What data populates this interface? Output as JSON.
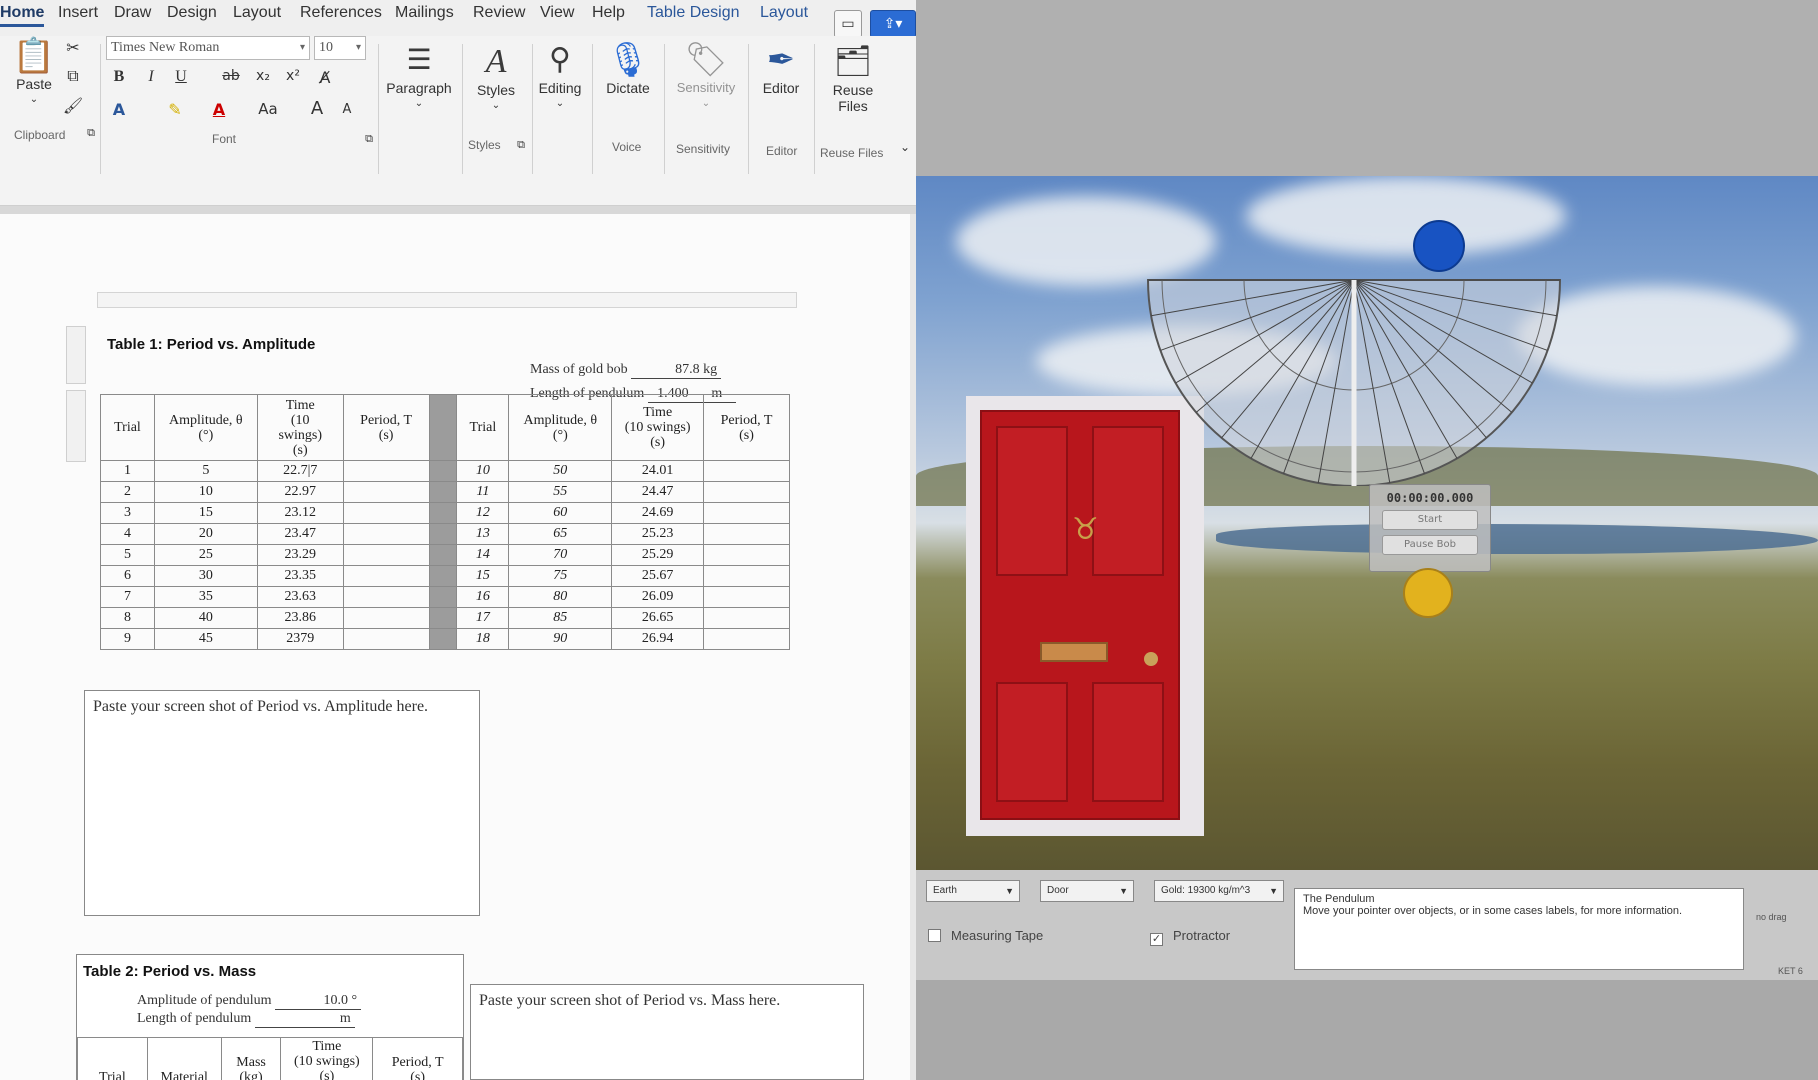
{
  "word": {
    "tabs": [
      {
        "label": "Home"
      },
      {
        "label": "Insert"
      },
      {
        "label": "Draw"
      },
      {
        "label": "Design"
      },
      {
        "label": "Layout"
      },
      {
        "label": "References"
      },
      {
        "label": "Mailings"
      },
      {
        "label": "Review"
      },
      {
        "label": "View"
      },
      {
        "label": "Help"
      },
      {
        "label": "Table Design"
      },
      {
        "label": "Layout"
      }
    ],
    "ribbon": {
      "paste_label": "Paste",
      "clipboard_group": "Clipboard",
      "font_name": "Times New Roman",
      "font_size": "10",
      "font_group": "Font",
      "bold": "B",
      "italic": "I",
      "underline": "U",
      "strike": "ab",
      "subscript": "x₂",
      "superscript": "x²",
      "case": "Aa",
      "grow": "A",
      "shrink": "A",
      "paragraph": "Paragraph",
      "styles": "Styles",
      "styles_group": "Styles",
      "editing": "Editing",
      "dictate": "Dictate",
      "voice_group": "Voice",
      "sensitivity": "Sensitivity",
      "sensitivity_group": "Sensitivity",
      "editor": "Editor",
      "editor_group": "Editor",
      "reuse_files_1": "Reuse",
      "reuse_files_2": "Files",
      "reuse_group": "Reuse Files"
    },
    "table1": {
      "caption": "Table 1:  Period vs. Amplitude",
      "mass_label": "Mass of gold bob",
      "mass_value": "87.8 kg",
      "length_label": "Length of pendulum",
      "length_value": "1.400",
      "length_unit": "m",
      "headers": {
        "trial": "Trial",
        "amplitude_1": "Amplitude, θ",
        "amplitude_2": "(°)",
        "time_1": "Time",
        "time_2": "(10",
        "time_3": "swings)",
        "time_4": "(s)",
        "time_r_1": "Time",
        "time_r_2": "(10 swings)",
        "time_r_3": "(s)",
        "period_1": "Period, T",
        "period_2": "(s)"
      },
      "left_rows": [
        {
          "trial": "1",
          "amp": "5",
          "time": "22.7|7"
        },
        {
          "trial": "2",
          "amp": "10",
          "time": "22.97"
        },
        {
          "trial": "3",
          "amp": "15",
          "time": "23.12"
        },
        {
          "trial": "4",
          "amp": "20",
          "time": "23.47"
        },
        {
          "trial": "5",
          "amp": "25",
          "time": "23.29"
        },
        {
          "trial": "6",
          "amp": "30",
          "time": "23.35"
        },
        {
          "trial": "7",
          "amp": "35",
          "time": "23.63"
        },
        {
          "trial": "8",
          "amp": "40",
          "time": "23.86"
        },
        {
          "trial": "9",
          "amp": "45",
          "time": "2379"
        }
      ],
      "right_rows": [
        {
          "trial": "10",
          "amp": "50",
          "time": "24.01"
        },
        {
          "trial": "11",
          "amp": "55",
          "time": "24.47"
        },
        {
          "trial": "12",
          "amp": "60",
          "time": "24.69"
        },
        {
          "trial": "13",
          "amp": "65",
          "time": "25.23"
        },
        {
          "trial": "14",
          "amp": "70",
          "time": "25.29"
        },
        {
          "trial": "15",
          "amp": "75",
          "time": "25.67"
        },
        {
          "trial": "16",
          "amp": "80",
          "time": "26.09"
        },
        {
          "trial": "17",
          "amp": "85",
          "time": "26.65"
        },
        {
          "trial": "18",
          "amp": "90",
          "time": "26.94"
        }
      ]
    },
    "paste_box_1": "Paste your screen shot of Period vs. Amplitude here.",
    "table2": {
      "caption": "Table 2:  Period vs. Mass",
      "amp_label": "Amplitude of pendulum",
      "amp_value": "10.0 °",
      "length_label": "Length of pendulum",
      "length_unit": "m",
      "headers": {
        "trial": "Trial",
        "material": "Material",
        "mass_1": "Mass",
        "mass_2": "(kg)",
        "time_1": "Time",
        "time_2": "(10 swings)",
        "time_3": "(s)",
        "period_1": "Period, T",
        "period_2": "(s)"
      }
    },
    "paste_box_2": "Paste your screen shot of Period vs. Mass here."
  },
  "sim": {
    "timer_value": "00:00:00.000",
    "start_button": "Start",
    "pause_button": "Pause Bob",
    "planet_select": "Earth",
    "object_select": "Door",
    "material_select": "Gold: 19300 kg/m^3",
    "measuring_tape": "Measuring Tape",
    "measuring_tape_checked": false,
    "protractor": "Protractor",
    "protractor_checked": true,
    "help_title": "The Pendulum",
    "help_text": "Move your pointer over objects, or in some cases labels, for more information.",
    "side_label_1": "no drag",
    "side_label_2": "KET 6"
  },
  "colors": {
    "door_red": "#b8161c",
    "pivot_blue": "#1853c2",
    "bob_gold": "#e2b21e",
    "word_accent": "#2b579a"
  }
}
